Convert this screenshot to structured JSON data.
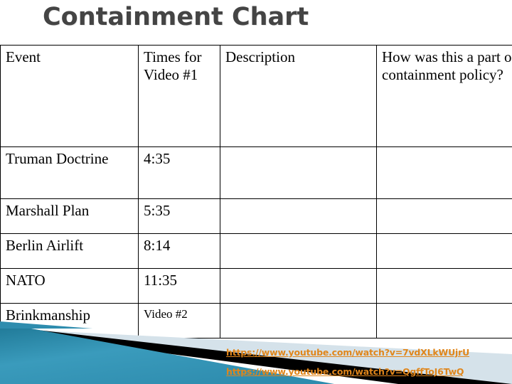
{
  "slide": {
    "title": "Containment Chart",
    "title_color": "#444444",
    "accent_teal": "#2E8CAE",
    "accent_pale_blue": "#D5E2EA",
    "link_color": "#E0861B"
  },
  "table": {
    "columns": [
      {
        "key": "event",
        "header": "Event"
      },
      {
        "key": "times",
        "header": "Times for Video #1"
      },
      {
        "key": "description",
        "header": "Description"
      },
      {
        "key": "how",
        "header": "How was this a part of containment policy?"
      }
    ],
    "rows": [
      {
        "event": "Truman Doctrine",
        "times": "4:35",
        "description": "",
        "how": ""
      },
      {
        "event": "Marshall Plan",
        "times": "5:35",
        "description": "",
        "how": ""
      },
      {
        "event": "Berlin Airlift",
        "times": "8:14",
        "description": "",
        "how": ""
      },
      {
        "event": "NATO",
        "times": "11:35",
        "description": "",
        "how": ""
      },
      {
        "event": "Brinkmanship",
        "times": "Video #2",
        "description": "",
        "how": ""
      }
    ]
  },
  "links": [
    {
      "label": "https://www.youtube.com/watch?v=7vdXLkWUjrU"
    },
    {
      "label": "https://www.youtube.com/watch?v=QgffToJ6TwQ"
    }
  ]
}
